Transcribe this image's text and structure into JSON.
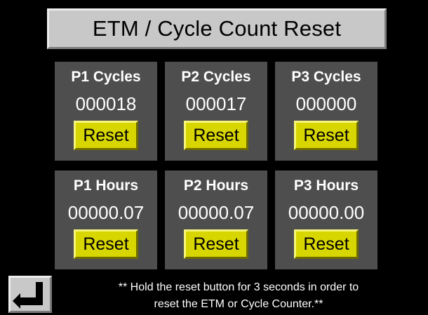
{
  "title": "ETM / Cycle Count Reset",
  "cycles": [
    {
      "label": "P1 Cycles",
      "value": "000018",
      "reset_label": "Reset"
    },
    {
      "label": "P2 Cycles",
      "value": "000017",
      "reset_label": "Reset"
    },
    {
      "label": "P3 Cycles",
      "value": "000000",
      "reset_label": "Reset"
    }
  ],
  "hours": [
    {
      "label": "P1 Hours",
      "value": "00000.07",
      "reset_label": "Reset"
    },
    {
      "label": "P2 Hours",
      "value": "00000.07",
      "reset_label": "Reset"
    },
    {
      "label": "P3 Hours",
      "value": "00000.00",
      "reset_label": "Reset"
    }
  ],
  "note": {
    "line1": "** Hold the reset button for 3 seconds in order to",
    "line2": "reset the ETM or Cycle Counter.**"
  },
  "icons": {
    "back": "return-arrow-icon"
  },
  "colors": {
    "background": "#000000",
    "panel": "#4e4e4e",
    "title_bar": "#c8c8c8",
    "reset_button": "#d8d600",
    "text": "#ffffff"
  }
}
